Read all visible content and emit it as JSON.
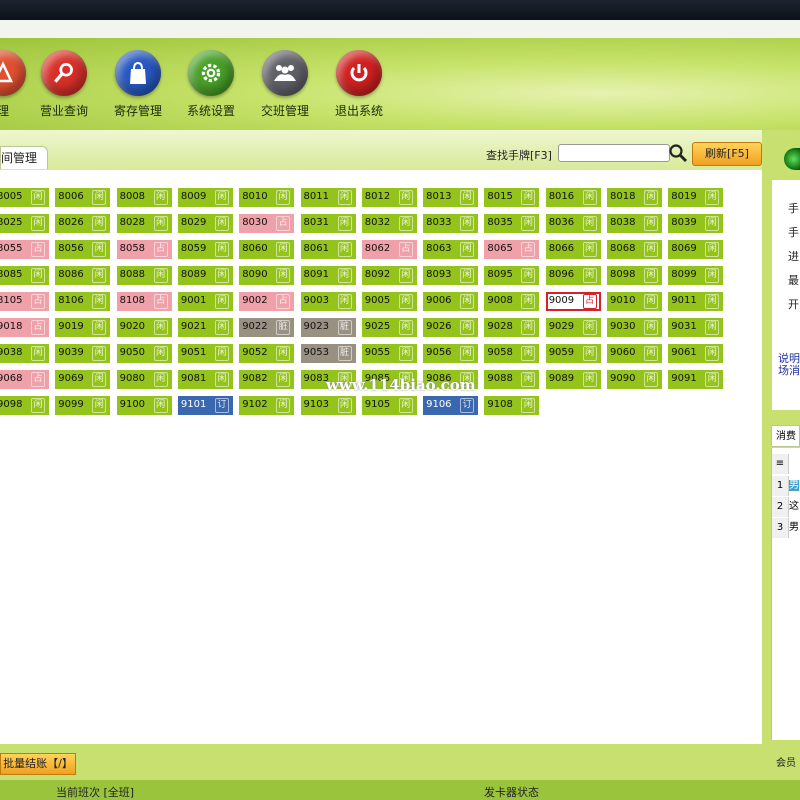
{
  "toolbar": {
    "items": [
      {
        "label": "理",
        "icon": "person-icon",
        "color": "#e05030"
      },
      {
        "label": "营业查询",
        "icon": "search-icon",
        "color": "#d83028"
      },
      {
        "label": "寄存管理",
        "icon": "bag-icon",
        "color": "#2858c0"
      },
      {
        "label": "系统设置",
        "icon": "gear-icon",
        "color": "#48a028"
      },
      {
        "label": "交班管理",
        "icon": "users-icon",
        "color": "#606068"
      },
      {
        "label": "退出系统",
        "icon": "power-icon",
        "color": "#d02020"
      }
    ]
  },
  "tab": {
    "label": "间管理"
  },
  "search": {
    "label": "查找手牌[F3]",
    "value": ""
  },
  "refresh": {
    "label": "刷新[F5]"
  },
  "rooms": [
    [
      "8005",
      "闲",
      "green"
    ],
    [
      "8006",
      "闲",
      "green"
    ],
    [
      "8008",
      "闲",
      "green"
    ],
    [
      "8009",
      "闲",
      "green"
    ],
    [
      "8010",
      "闲",
      "green"
    ],
    [
      "8011",
      "闲",
      "green"
    ],
    [
      "8012",
      "闲",
      "green"
    ],
    [
      "8013",
      "闲",
      "green"
    ],
    [
      "8015",
      "闲",
      "green"
    ],
    [
      "8016",
      "闲",
      "green"
    ],
    [
      "8018",
      "闲",
      "green"
    ],
    [
      "8019",
      "闲",
      "green"
    ],
    [
      "8025",
      "闲",
      "green"
    ],
    [
      "8026",
      "闲",
      "green"
    ],
    [
      "8028",
      "闲",
      "green"
    ],
    [
      "8029",
      "闲",
      "green"
    ],
    [
      "8030",
      "占",
      "pink"
    ],
    [
      "8031",
      "闲",
      "green"
    ],
    [
      "8032",
      "闲",
      "green"
    ],
    [
      "8033",
      "闲",
      "green"
    ],
    [
      "8035",
      "闲",
      "green"
    ],
    [
      "8036",
      "闲",
      "green"
    ],
    [
      "8038",
      "闲",
      "green"
    ],
    [
      "8039",
      "闲",
      "green"
    ],
    [
      "8055",
      "占",
      "pink"
    ],
    [
      "8056",
      "闲",
      "green"
    ],
    [
      "8058",
      "占",
      "pink"
    ],
    [
      "8059",
      "闲",
      "green"
    ],
    [
      "8060",
      "闲",
      "green"
    ],
    [
      "8061",
      "闲",
      "green"
    ],
    [
      "8062",
      "占",
      "pink"
    ],
    [
      "8063",
      "闲",
      "green"
    ],
    [
      "8065",
      "占",
      "pink"
    ],
    [
      "8066",
      "闲",
      "green"
    ],
    [
      "8068",
      "闲",
      "green"
    ],
    [
      "8069",
      "闲",
      "green"
    ],
    [
      "8085",
      "闲",
      "green"
    ],
    [
      "8086",
      "闲",
      "green"
    ],
    [
      "8088",
      "闲",
      "green"
    ],
    [
      "8089",
      "闲",
      "green"
    ],
    [
      "8090",
      "闲",
      "green"
    ],
    [
      "8091",
      "闲",
      "green"
    ],
    [
      "8092",
      "闲",
      "green"
    ],
    [
      "8093",
      "闲",
      "green"
    ],
    [
      "8095",
      "闲",
      "green"
    ],
    [
      "8096",
      "闲",
      "green"
    ],
    [
      "8098",
      "闲",
      "green"
    ],
    [
      "8099",
      "闲",
      "green"
    ],
    [
      "8105",
      "占",
      "pink"
    ],
    [
      "8106",
      "闲",
      "green"
    ],
    [
      "8108",
      "占",
      "pink"
    ],
    [
      "9001",
      "闲",
      "green"
    ],
    [
      "9002",
      "占",
      "pink"
    ],
    [
      "9003",
      "闲",
      "green"
    ],
    [
      "9005",
      "闲",
      "green"
    ],
    [
      "9006",
      "闲",
      "green"
    ],
    [
      "9008",
      "闲",
      "green"
    ],
    [
      "9009",
      "占",
      "sel"
    ],
    [
      "9010",
      "闲",
      "green"
    ],
    [
      "9011",
      "闲",
      "green"
    ],
    [
      "9018",
      "占",
      "pink"
    ],
    [
      "9019",
      "闲",
      "green"
    ],
    [
      "9020",
      "闲",
      "green"
    ],
    [
      "9021",
      "闲",
      "green"
    ],
    [
      "9022",
      "脏",
      "gray"
    ],
    [
      "9023",
      "脏",
      "gray"
    ],
    [
      "9025",
      "闲",
      "green"
    ],
    [
      "9026",
      "闲",
      "green"
    ],
    [
      "9028",
      "闲",
      "green"
    ],
    [
      "9029",
      "闲",
      "green"
    ],
    [
      "9030",
      "闲",
      "green"
    ],
    [
      "9031",
      "闲",
      "green"
    ],
    [
      "9038",
      "闲",
      "green"
    ],
    [
      "9039",
      "闲",
      "green"
    ],
    [
      "9050",
      "闲",
      "green"
    ],
    [
      "9051",
      "闲",
      "green"
    ],
    [
      "9052",
      "闲",
      "green"
    ],
    [
      "9053",
      "脏",
      "gray"
    ],
    [
      "9055",
      "闲",
      "green"
    ],
    [
      "9056",
      "闲",
      "green"
    ],
    [
      "9058",
      "闲",
      "green"
    ],
    [
      "9059",
      "闲",
      "green"
    ],
    [
      "9060",
      "闲",
      "green"
    ],
    [
      "9061",
      "闲",
      "green"
    ],
    [
      "9068",
      "占",
      "pink"
    ],
    [
      "9069",
      "闲",
      "green"
    ],
    [
      "9080",
      "闲",
      "green"
    ],
    [
      "9081",
      "闲",
      "green"
    ],
    [
      "9082",
      "闲",
      "green"
    ],
    [
      "9083",
      "闲",
      "green"
    ],
    [
      "9085",
      "闲",
      "green"
    ],
    [
      "9086",
      "闲",
      "green"
    ],
    [
      "9088",
      "闲",
      "green"
    ],
    [
      "9089",
      "闲",
      "green"
    ],
    [
      "9090",
      "闲",
      "green"
    ],
    [
      "9091",
      "闲",
      "green"
    ],
    [
      "9098",
      "闲",
      "green"
    ],
    [
      "9099",
      "闲",
      "green"
    ],
    [
      "9100",
      "闲",
      "green"
    ],
    [
      "9101",
      "订",
      "blue"
    ],
    [
      "9102",
      "闲",
      "green"
    ],
    [
      "9103",
      "闲",
      "green"
    ],
    [
      "9105",
      "闲",
      "green"
    ],
    [
      "9106",
      "订",
      "blue"
    ],
    [
      "9108",
      "闲",
      "green"
    ]
  ],
  "watermark": "www.114biao.com",
  "batch_button": "批量结账【/】",
  "status": {
    "shift": "当前班次 [全班]",
    "card_reader": "发卡器状态"
  },
  "right_panel": {
    "info": [
      "手",
      "手",
      "进",
      "最",
      "开"
    ],
    "note": [
      "说明",
      "场消"
    ],
    "tab": "消费明",
    "rows": [
      {
        "n": "1",
        "t": "男"
      },
      {
        "n": "2",
        "t": "这"
      },
      {
        "n": "3",
        "t": "男"
      }
    ],
    "footer": "会员"
  }
}
